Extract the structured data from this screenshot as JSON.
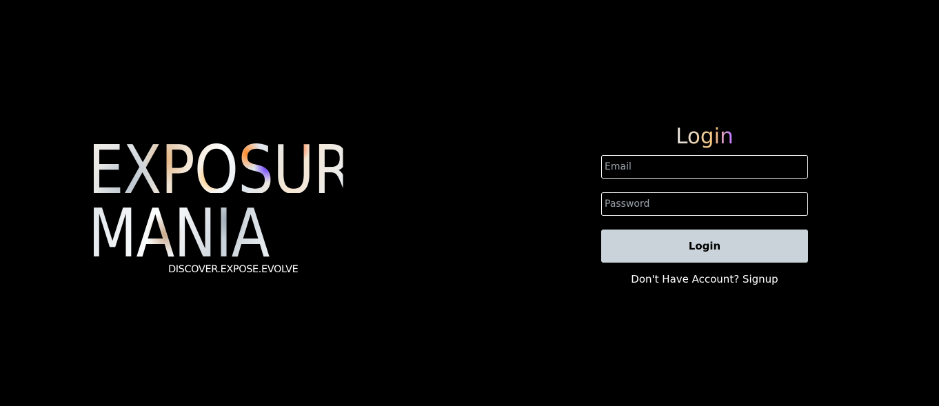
{
  "brand": {
    "line1": "EXPOSURE",
    "line2": "MANIA",
    "tagline": "DISCOVER.EXPOSE.EVOLVE"
  },
  "login": {
    "title": "Login",
    "email_placeholder": "Email",
    "password_placeholder": "Password",
    "button_label": "Login",
    "signup_prompt": "Don't Have Account?",
    "signup_link": "Signup"
  },
  "colors": {
    "background": "#000000",
    "button_bg": "#c9d3d9",
    "text": "#ffffff"
  }
}
